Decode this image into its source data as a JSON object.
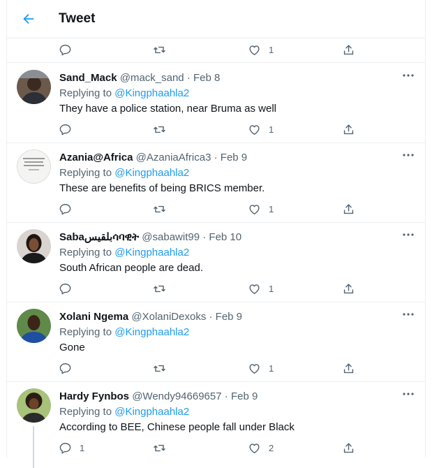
{
  "header": {
    "title": "Tweet"
  },
  "top_actions": {
    "like_count": "1"
  },
  "tweets": [
    {
      "name": "Sand_Mack",
      "handle": "@mack_sand",
      "date": "Feb 8",
      "reply_prefix": "Replying to",
      "reply_to": "@Kingphaahla2",
      "text": "They have a police station, near Bruma as well",
      "reply_count": "",
      "retweet_count": "",
      "like_count": "1"
    },
    {
      "name": "Azania@Africa",
      "handle": "@AzaniaAfrica3",
      "date": "Feb 9",
      "reply_prefix": "Replying to",
      "reply_to": "@Kingphaahla2",
      "text": "These are benefits of being BRICS member.",
      "reply_count": "",
      "retweet_count": "",
      "like_count": "1"
    },
    {
      "name": "Sabaبلقيسሳባዊት",
      "handle": "@sabawit99",
      "date": "Feb 10",
      "reply_prefix": "Replying to",
      "reply_to": "@Kingphaahla2",
      "text": "South African people are dead.",
      "reply_count": "",
      "retweet_count": "",
      "like_count": "1"
    },
    {
      "name": "Xolani Ngema",
      "handle": "@XolaniDexoks",
      "date": "Feb 9",
      "reply_prefix": "Replying to",
      "reply_to": "@Kingphaahla2",
      "text": "Gone",
      "reply_count": "",
      "retweet_count": "",
      "like_count": "1"
    },
    {
      "name": "Hardy Fynbos",
      "handle": "@Wendy94669657",
      "date": "Feb 9",
      "reply_prefix": "Replying to",
      "reply_to": "@Kingphaahla2",
      "text": "According to BEE, Chinese people fall under Black",
      "reply_count": "1",
      "retweet_count": "",
      "like_count": "2"
    }
  ],
  "separator": "·",
  "icons": {
    "back": "arrow-left-icon",
    "reply": "reply-icon",
    "retweet": "retweet-icon",
    "like": "heart-icon",
    "share": "share-icon",
    "more": "more-icon"
  },
  "colors": {
    "accent": "#1d9bf0",
    "text": "#0f1419",
    "muted": "#536471",
    "border": "#ebeef0"
  }
}
